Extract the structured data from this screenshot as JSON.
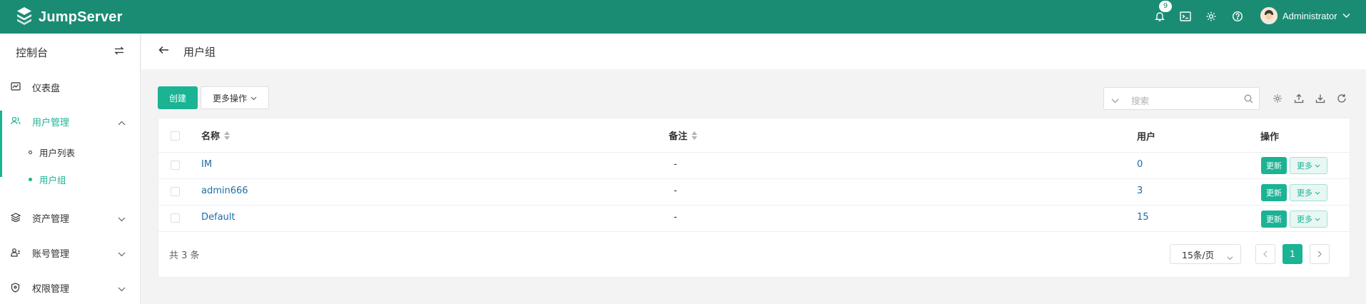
{
  "header": {
    "brand": "JumpServer",
    "notification_count": "9",
    "user_name": "Administrator"
  },
  "sidebar": {
    "title": "控制台",
    "items": [
      {
        "label": "仪表盘",
        "icon": "dashboard-icon"
      },
      {
        "label": "用户管理",
        "icon": "users-icon",
        "expanded": true,
        "children": [
          {
            "label": "用户列表"
          },
          {
            "label": "用户组",
            "active": true
          }
        ]
      },
      {
        "label": "资产管理",
        "icon": "layers-icon"
      },
      {
        "label": "账号管理",
        "icon": "account-icon"
      },
      {
        "label": "权限管理",
        "icon": "shield-icon"
      }
    ]
  },
  "page": {
    "title": "用户组"
  },
  "toolbar": {
    "create_label": "创建",
    "more_actions_label": "更多操作",
    "search_placeholder": "搜索"
  },
  "table": {
    "columns": {
      "name": "名称",
      "comment": "备注",
      "users": "用户",
      "actions": "操作"
    },
    "rows": [
      {
        "name": "IM",
        "comment": "-",
        "users": "0"
      },
      {
        "name": "admin666",
        "comment": "-",
        "users": "3"
      },
      {
        "name": "Default",
        "comment": "-",
        "users": "15"
      }
    ],
    "update_label": "更新",
    "more_label": "更多"
  },
  "pagination": {
    "total_text": "共 3 条",
    "page_size": "15条/页",
    "current_page": "1"
  },
  "colors": {
    "header_bg": "#1a8c73",
    "primary": "#1ab394",
    "link": "#1c6ea4"
  }
}
